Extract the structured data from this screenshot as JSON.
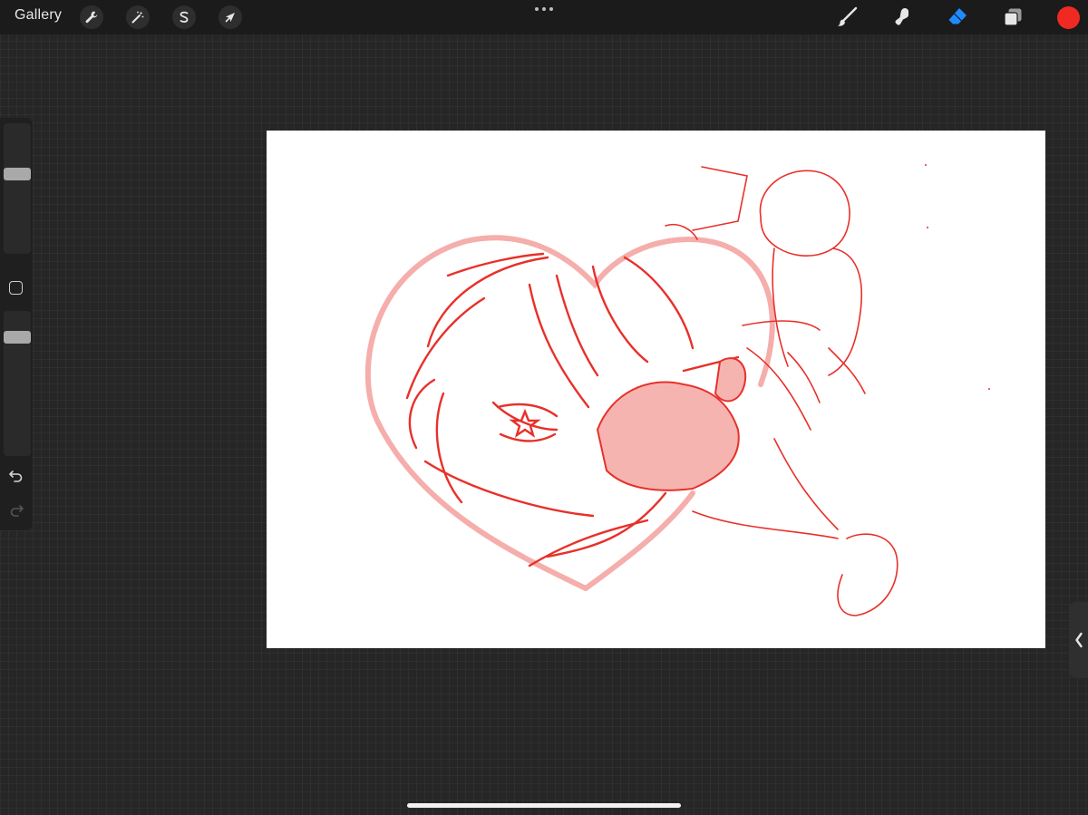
{
  "toolbar": {
    "gallery_label": "Gallery",
    "left_tools": [
      {
        "name": "actions",
        "icon": "wrench-icon"
      },
      {
        "name": "adjustments",
        "icon": "magic-wand-icon"
      },
      {
        "name": "selection",
        "icon": "selection-s-icon"
      },
      {
        "name": "transform",
        "icon": "arrow-cursor-icon"
      }
    ],
    "right_tools": [
      {
        "name": "brush",
        "icon": "brush-icon"
      },
      {
        "name": "smudge",
        "icon": "smudge-icon"
      },
      {
        "name": "eraser",
        "icon": "eraser-icon",
        "active": true
      },
      {
        "name": "layers",
        "icon": "layers-icon"
      }
    ],
    "current_color": "#f02a22",
    "active_tool_color": "#1e8bff"
  },
  "sidebar": {
    "brush_size_level": 0.62,
    "opacity_level": 0.85,
    "icons": [
      "modify-square-icon",
      "undo-icon",
      "redo-icon"
    ]
  },
  "canvas": {
    "background": "#ffffff",
    "sketch_primary_color": "#e8302a",
    "sketch_secondary_color": "#f4a6a3"
  },
  "panel_tab": {
    "icon": "chevron-left-icon"
  }
}
